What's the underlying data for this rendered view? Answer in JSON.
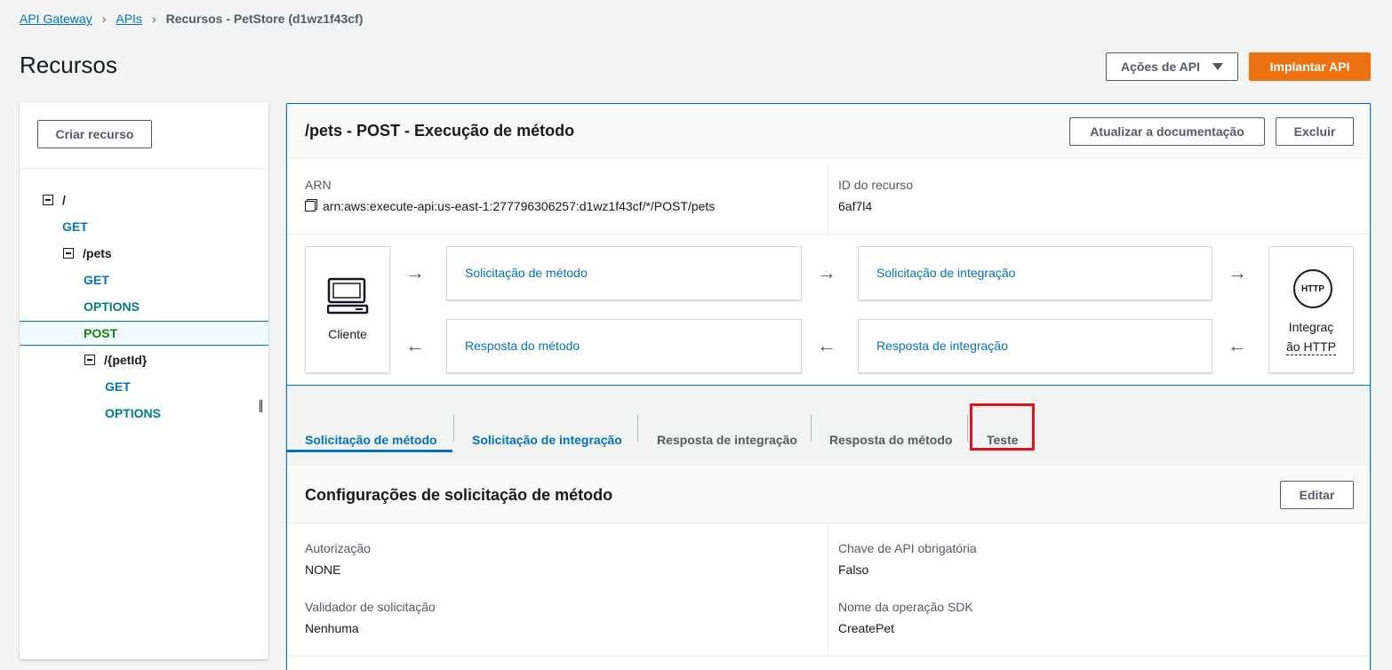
{
  "breadcrumb": {
    "item1": "API Gateway",
    "item2": "APIs",
    "current": "Recursos - PetStore (d1wz1f43cf)"
  },
  "page": {
    "title": "Recursos",
    "actions_button": "Ações de API",
    "deploy_button": "Implantar API"
  },
  "sidebar": {
    "create_button": "Criar recurso",
    "tree": [
      {
        "label": "/",
        "type": "resource"
      },
      {
        "label": "GET",
        "type": "method"
      },
      {
        "label": "/pets",
        "type": "resource"
      },
      {
        "label": "GET",
        "type": "method"
      },
      {
        "label": "OPTIONS",
        "type": "method"
      },
      {
        "label": "POST",
        "type": "method",
        "selected": true
      },
      {
        "label": "/{petId}",
        "type": "resource"
      },
      {
        "label": "GET",
        "type": "method"
      },
      {
        "label": "OPTIONS",
        "type": "method"
      }
    ]
  },
  "main": {
    "title": "/pets - POST - Execução de método",
    "update_docs_button": "Atualizar a documentação",
    "delete_button": "Excluir",
    "arn_label": "ARN",
    "arn_value": "arn:aws:execute-api:us-east-1:277796306257:d1wz1f43cf/*/POST/pets",
    "resource_id_label": "ID do recurso",
    "resource_id_value": "6af7l4",
    "flow": {
      "client": "Cliente",
      "method_request": "Solicitação de método",
      "integration_request": "Solicitação de integração",
      "method_response": "Resposta do método",
      "integration_response": "Resposta de integração",
      "http_badge": "HTTP",
      "http_label_line1": "Integraç",
      "http_label_line2": "ão HTTP"
    },
    "tabs": [
      "Solicitação de método",
      "Solicitação de integração",
      "Resposta de integração",
      "Resposta do método",
      "Teste"
    ],
    "settings": {
      "title": "Configurações de solicitação de método",
      "edit_button": "Editar",
      "authorization_label": "Autorização",
      "authorization_value": "NONE",
      "api_key_label": "Chave de API obrigatória",
      "api_key_value": "Falso",
      "validator_label": "Validador de solicitação",
      "validator_value": "Nenhuma",
      "sdk_label": "Nome da operação SDK",
      "sdk_value": "CreatePet"
    }
  }
}
